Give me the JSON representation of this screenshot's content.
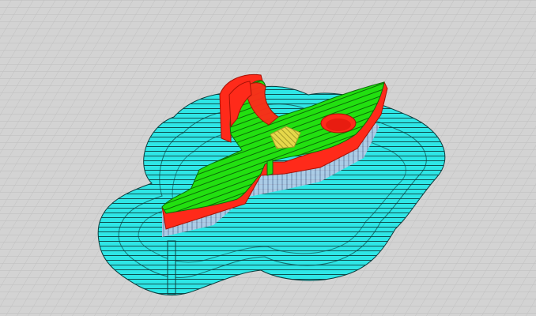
{
  "viewport": {
    "background": "#d3d3d3",
    "grid_color": "#b8b8b8",
    "grid_major_color": "#a8a8a8"
  },
  "layers": [
    {
      "name": "brim",
      "color": "#2ee6e6",
      "line_color": "#0b3d3d"
    },
    {
      "name": "support",
      "color": "#c7d3ea"
    },
    {
      "name": "outer-wall",
      "color": "#ff2a1a"
    },
    {
      "name": "top-skin",
      "color": "#22e010"
    },
    {
      "name": "infill",
      "color": "#e6d84a"
    }
  ]
}
